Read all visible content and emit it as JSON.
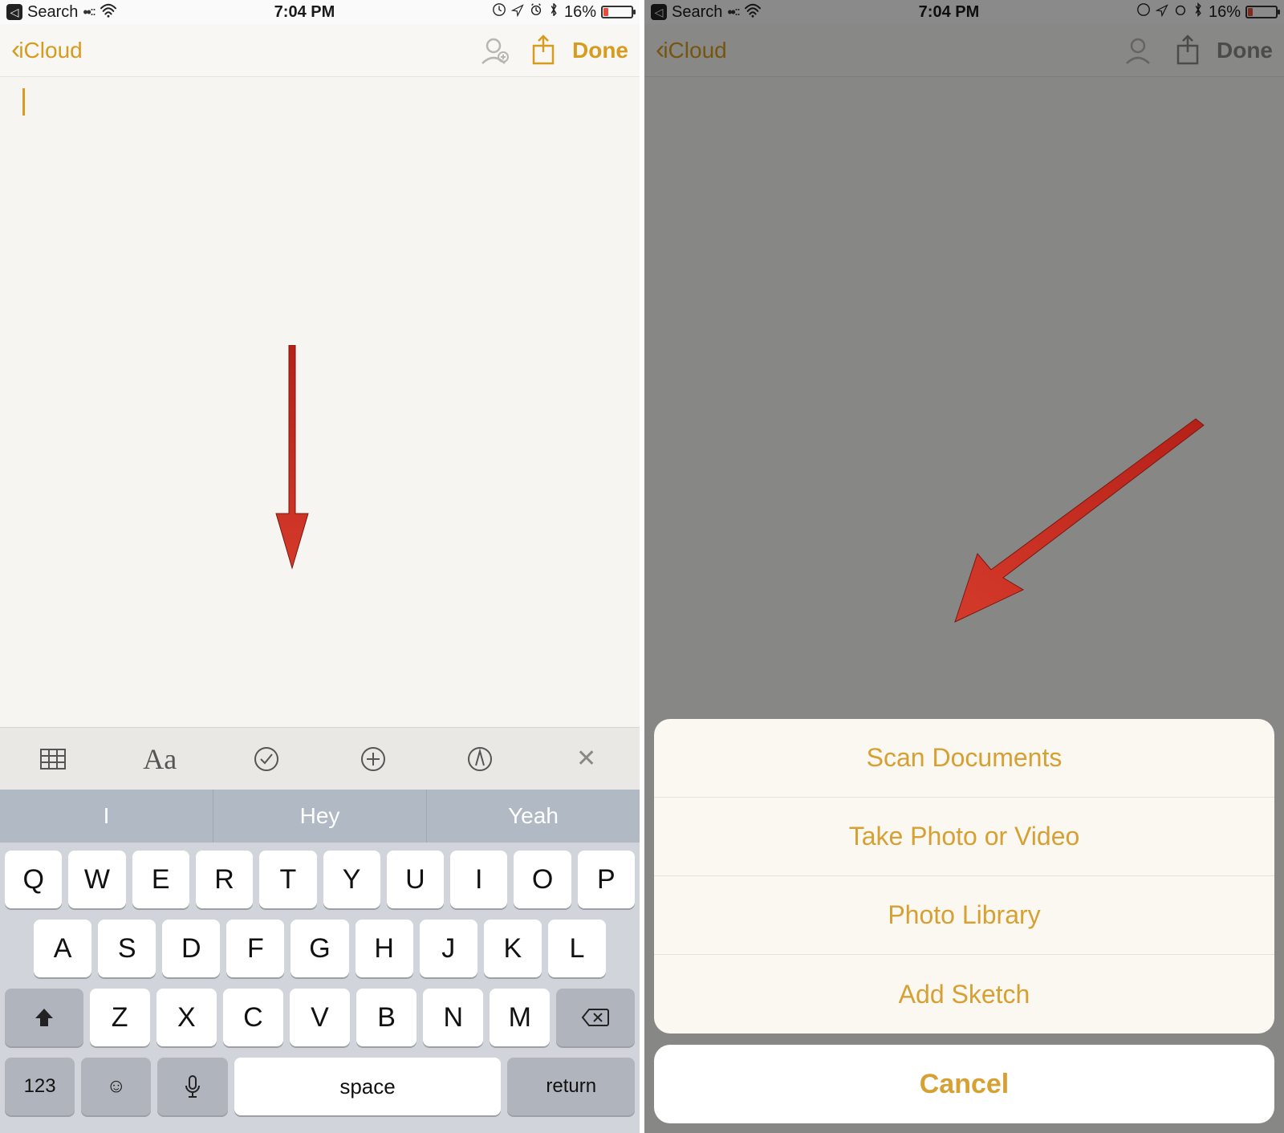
{
  "status": {
    "search_label": "Search",
    "time": "7:04 PM",
    "battery_pct": "16%"
  },
  "nav": {
    "back_label": "iCloud",
    "done_label": "Done"
  },
  "keyboard": {
    "suggestions": [
      "I",
      "Hey",
      "Yeah"
    ],
    "row1": [
      "Q",
      "W",
      "E",
      "R",
      "T",
      "Y",
      "U",
      "I",
      "O",
      "P"
    ],
    "row2": [
      "A",
      "S",
      "D",
      "F",
      "G",
      "H",
      "J",
      "K",
      "L"
    ],
    "row3": [
      "Z",
      "X",
      "C",
      "V",
      "B",
      "N",
      "M"
    ],
    "numkey": "123",
    "space": "space",
    "return": "return"
  },
  "sheet": {
    "items": [
      "Scan Documents",
      "Take Photo or Video",
      "Photo Library",
      "Add Sketch"
    ],
    "cancel": "Cancel"
  }
}
